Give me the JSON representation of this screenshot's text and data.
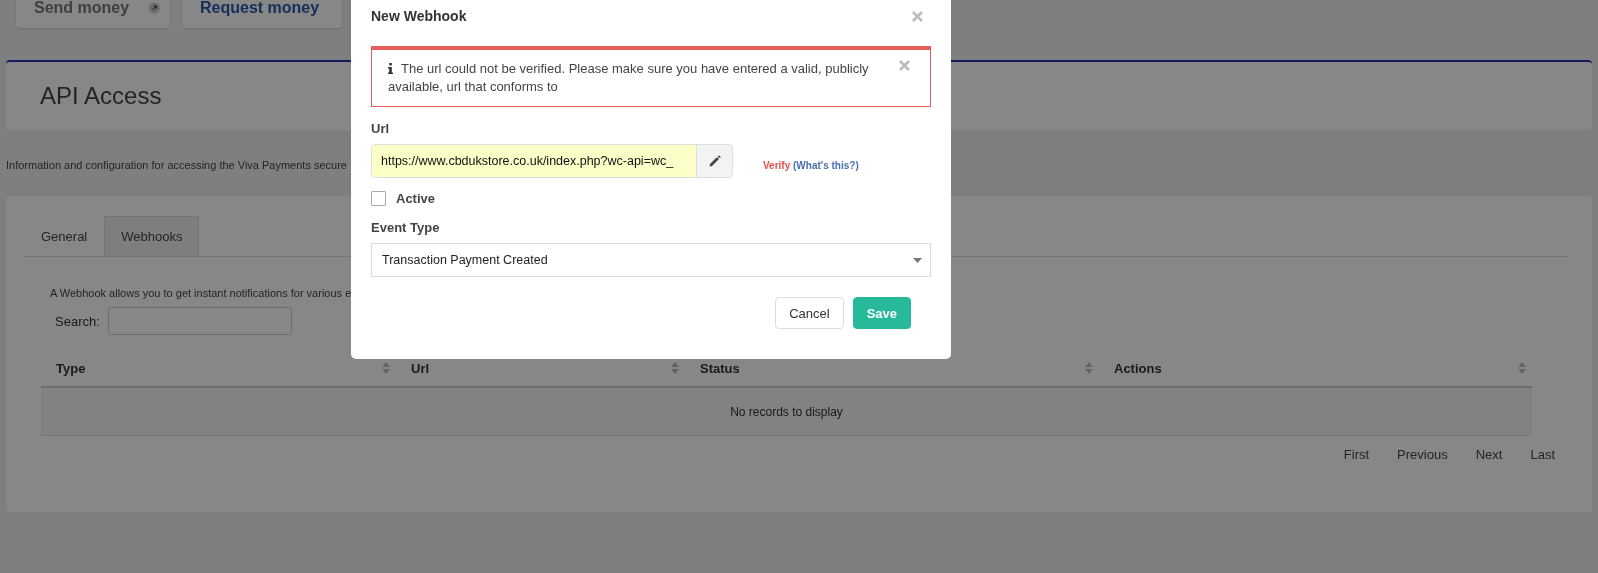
{
  "top_buttons": [
    {
      "label": "Send money",
      "kind": "send"
    },
    {
      "label": "Request money",
      "kind": "request"
    }
  ],
  "page": {
    "title": "API Access",
    "description": "Information and configuration for accessing the Viva Payments secure"
  },
  "tabs": [
    {
      "label": "General",
      "selected": false
    },
    {
      "label": "Webhooks",
      "selected": true
    }
  ],
  "webhooks_intro": "A Webhook allows you to get instant notifications for various e",
  "search": {
    "label": "Search:"
  },
  "table": {
    "columns": [
      {
        "label": "Type"
      },
      {
        "label": "Url"
      },
      {
        "label": "Status"
      },
      {
        "label": "Actions"
      }
    ],
    "empty_message": "No records to display"
  },
  "pagination": [
    "First",
    "Previous",
    "Next",
    "Last"
  ],
  "dialog": {
    "title": "New Webhook",
    "alert": "The url could not be verified. Please make sure you have entered a valid, publicly available, url that conforms to",
    "url_label": "Url",
    "url_value": "https://www.cbdukstore.co.uk/index.php?wc-api=wc_",
    "verify": "Verify",
    "whats_this": "(What's this?)",
    "active": {
      "label": "Active",
      "checked": false
    },
    "event_type_label": "Event Type",
    "event_type": "Transaction Payment Created",
    "buttons": [
      {
        "label": "Cancel",
        "kind": "secondary"
      },
      {
        "label": "Save",
        "kind": "primary"
      }
    ]
  }
}
